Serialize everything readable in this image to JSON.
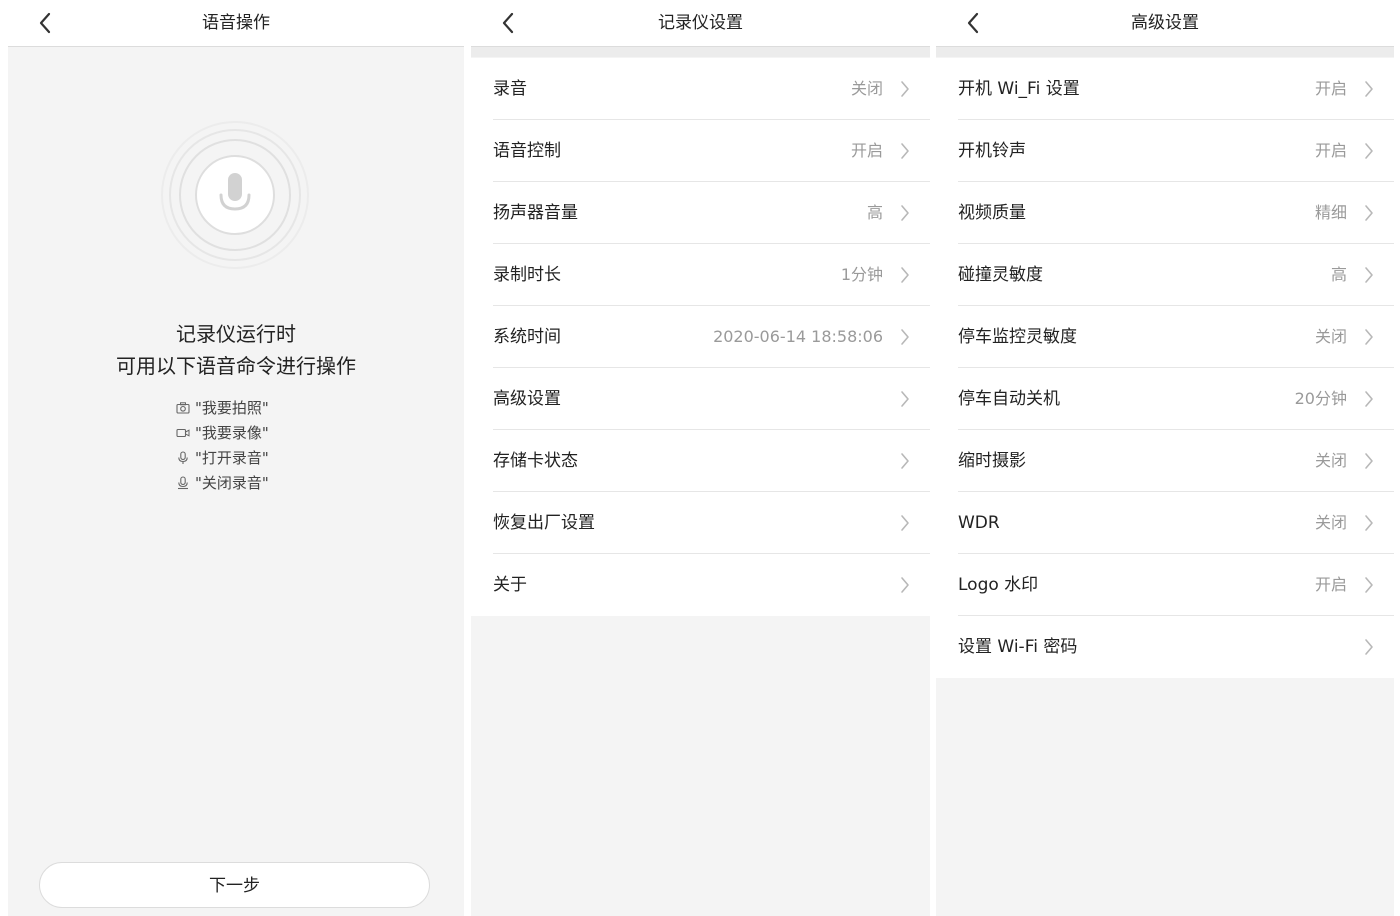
{
  "screen1": {
    "title": "语音操作",
    "heading_line1": "记录仪运行时",
    "heading_line2": "可用以下语音命令进行操作",
    "commands": [
      {
        "icon": "camera-icon",
        "text": "\"我要拍照\""
      },
      {
        "icon": "video-camera-icon",
        "text": "\"我要录像\""
      },
      {
        "icon": "microphone-icon",
        "text": "\"打开录音\""
      },
      {
        "icon": "microphone-off-icon",
        "text": "\"关闭录音\""
      }
    ],
    "next_label": "下一步"
  },
  "screen2": {
    "title": "记录仪设置",
    "items": [
      {
        "label": "录音",
        "value": "关闭"
      },
      {
        "label": "语音控制",
        "value": "开启"
      },
      {
        "label": "扬声器音量",
        "value": "高"
      },
      {
        "label": "录制时长",
        "value": "1分钟"
      },
      {
        "label": "系统时间",
        "value": "2020-06-14 18:58:06"
      },
      {
        "label": "高级设置",
        "value": ""
      },
      {
        "label": "存储卡状态",
        "value": ""
      },
      {
        "label": "恢复出厂设置",
        "value": ""
      },
      {
        "label": "关于",
        "value": ""
      }
    ]
  },
  "screen3": {
    "title": "高级设置",
    "items": [
      {
        "label": "开机 Wi_Fi 设置",
        "value": "开启"
      },
      {
        "label": "开机铃声",
        "value": "开启"
      },
      {
        "label": "视频质量",
        "value": "精细"
      },
      {
        "label": "碰撞灵敏度",
        "value": "高"
      },
      {
        "label": "停车监控灵敏度",
        "value": "关闭"
      },
      {
        "label": "停车自动关机",
        "value": "20分钟"
      },
      {
        "label": "缩时摄影",
        "value": "关闭"
      },
      {
        "label": "WDR",
        "value": "关闭"
      },
      {
        "label": "Logo 水印",
        "value": "开启"
      },
      {
        "label": "设置 Wi-Fi 密码",
        "value": ""
      }
    ]
  },
  "colors": {
    "background": "#f4f4f4",
    "text": "#222222",
    "secondary_text": "#9a9a9a",
    "divider": "#e6e6e6"
  }
}
